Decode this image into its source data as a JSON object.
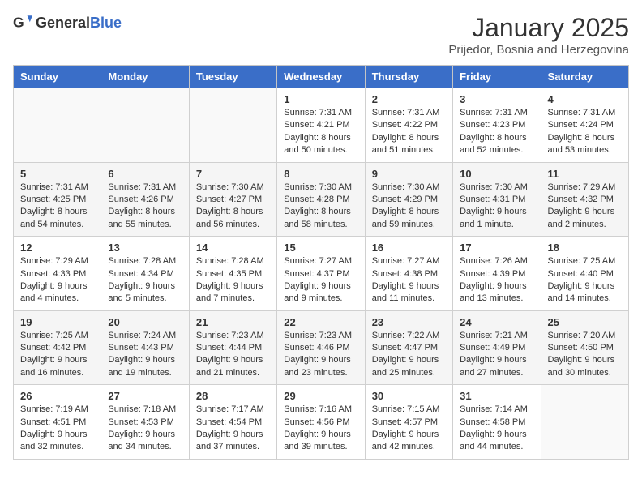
{
  "header": {
    "logo_general": "General",
    "logo_blue": "Blue",
    "month_title": "January 2025",
    "subtitle": "Prijedor, Bosnia and Herzegovina"
  },
  "weekdays": [
    "Sunday",
    "Monday",
    "Tuesday",
    "Wednesday",
    "Thursday",
    "Friday",
    "Saturday"
  ],
  "weeks": [
    [
      {
        "day": "",
        "sunrise": "",
        "sunset": "",
        "daylight": ""
      },
      {
        "day": "",
        "sunrise": "",
        "sunset": "",
        "daylight": ""
      },
      {
        "day": "",
        "sunrise": "",
        "sunset": "",
        "daylight": ""
      },
      {
        "day": "1",
        "sunrise": "Sunrise: 7:31 AM",
        "sunset": "Sunset: 4:21 PM",
        "daylight": "Daylight: 8 hours and 50 minutes."
      },
      {
        "day": "2",
        "sunrise": "Sunrise: 7:31 AM",
        "sunset": "Sunset: 4:22 PM",
        "daylight": "Daylight: 8 hours and 51 minutes."
      },
      {
        "day": "3",
        "sunrise": "Sunrise: 7:31 AM",
        "sunset": "Sunset: 4:23 PM",
        "daylight": "Daylight: 8 hours and 52 minutes."
      },
      {
        "day": "4",
        "sunrise": "Sunrise: 7:31 AM",
        "sunset": "Sunset: 4:24 PM",
        "daylight": "Daylight: 8 hours and 53 minutes."
      }
    ],
    [
      {
        "day": "5",
        "sunrise": "Sunrise: 7:31 AM",
        "sunset": "Sunset: 4:25 PM",
        "daylight": "Daylight: 8 hours and 54 minutes."
      },
      {
        "day": "6",
        "sunrise": "Sunrise: 7:31 AM",
        "sunset": "Sunset: 4:26 PM",
        "daylight": "Daylight: 8 hours and 55 minutes."
      },
      {
        "day": "7",
        "sunrise": "Sunrise: 7:30 AM",
        "sunset": "Sunset: 4:27 PM",
        "daylight": "Daylight: 8 hours and 56 minutes."
      },
      {
        "day": "8",
        "sunrise": "Sunrise: 7:30 AM",
        "sunset": "Sunset: 4:28 PM",
        "daylight": "Daylight: 8 hours and 58 minutes."
      },
      {
        "day": "9",
        "sunrise": "Sunrise: 7:30 AM",
        "sunset": "Sunset: 4:29 PM",
        "daylight": "Daylight: 8 hours and 59 minutes."
      },
      {
        "day": "10",
        "sunrise": "Sunrise: 7:30 AM",
        "sunset": "Sunset: 4:31 PM",
        "daylight": "Daylight: 9 hours and 1 minute."
      },
      {
        "day": "11",
        "sunrise": "Sunrise: 7:29 AM",
        "sunset": "Sunset: 4:32 PM",
        "daylight": "Daylight: 9 hours and 2 minutes."
      }
    ],
    [
      {
        "day": "12",
        "sunrise": "Sunrise: 7:29 AM",
        "sunset": "Sunset: 4:33 PM",
        "daylight": "Daylight: 9 hours and 4 minutes."
      },
      {
        "day": "13",
        "sunrise": "Sunrise: 7:28 AM",
        "sunset": "Sunset: 4:34 PM",
        "daylight": "Daylight: 9 hours and 5 minutes."
      },
      {
        "day": "14",
        "sunrise": "Sunrise: 7:28 AM",
        "sunset": "Sunset: 4:35 PM",
        "daylight": "Daylight: 9 hours and 7 minutes."
      },
      {
        "day": "15",
        "sunrise": "Sunrise: 7:27 AM",
        "sunset": "Sunset: 4:37 PM",
        "daylight": "Daylight: 9 hours and 9 minutes."
      },
      {
        "day": "16",
        "sunrise": "Sunrise: 7:27 AM",
        "sunset": "Sunset: 4:38 PM",
        "daylight": "Daylight: 9 hours and 11 minutes."
      },
      {
        "day": "17",
        "sunrise": "Sunrise: 7:26 AM",
        "sunset": "Sunset: 4:39 PM",
        "daylight": "Daylight: 9 hours and 13 minutes."
      },
      {
        "day": "18",
        "sunrise": "Sunrise: 7:25 AM",
        "sunset": "Sunset: 4:40 PM",
        "daylight": "Daylight: 9 hours and 14 minutes."
      }
    ],
    [
      {
        "day": "19",
        "sunrise": "Sunrise: 7:25 AM",
        "sunset": "Sunset: 4:42 PM",
        "daylight": "Daylight: 9 hours and 16 minutes."
      },
      {
        "day": "20",
        "sunrise": "Sunrise: 7:24 AM",
        "sunset": "Sunset: 4:43 PM",
        "daylight": "Daylight: 9 hours and 19 minutes."
      },
      {
        "day": "21",
        "sunrise": "Sunrise: 7:23 AM",
        "sunset": "Sunset: 4:44 PM",
        "daylight": "Daylight: 9 hours and 21 minutes."
      },
      {
        "day": "22",
        "sunrise": "Sunrise: 7:23 AM",
        "sunset": "Sunset: 4:46 PM",
        "daylight": "Daylight: 9 hours and 23 minutes."
      },
      {
        "day": "23",
        "sunrise": "Sunrise: 7:22 AM",
        "sunset": "Sunset: 4:47 PM",
        "daylight": "Daylight: 9 hours and 25 minutes."
      },
      {
        "day": "24",
        "sunrise": "Sunrise: 7:21 AM",
        "sunset": "Sunset: 4:49 PM",
        "daylight": "Daylight: 9 hours and 27 minutes."
      },
      {
        "day": "25",
        "sunrise": "Sunrise: 7:20 AM",
        "sunset": "Sunset: 4:50 PM",
        "daylight": "Daylight: 9 hours and 30 minutes."
      }
    ],
    [
      {
        "day": "26",
        "sunrise": "Sunrise: 7:19 AM",
        "sunset": "Sunset: 4:51 PM",
        "daylight": "Daylight: 9 hours and 32 minutes."
      },
      {
        "day": "27",
        "sunrise": "Sunrise: 7:18 AM",
        "sunset": "Sunset: 4:53 PM",
        "daylight": "Daylight: 9 hours and 34 minutes."
      },
      {
        "day": "28",
        "sunrise": "Sunrise: 7:17 AM",
        "sunset": "Sunset: 4:54 PM",
        "daylight": "Daylight: 9 hours and 37 minutes."
      },
      {
        "day": "29",
        "sunrise": "Sunrise: 7:16 AM",
        "sunset": "Sunset: 4:56 PM",
        "daylight": "Daylight: 9 hours and 39 minutes."
      },
      {
        "day": "30",
        "sunrise": "Sunrise: 7:15 AM",
        "sunset": "Sunset: 4:57 PM",
        "daylight": "Daylight: 9 hours and 42 minutes."
      },
      {
        "day": "31",
        "sunrise": "Sunrise: 7:14 AM",
        "sunset": "Sunset: 4:58 PM",
        "daylight": "Daylight: 9 hours and 44 minutes."
      },
      {
        "day": "",
        "sunrise": "",
        "sunset": "",
        "daylight": ""
      }
    ]
  ]
}
